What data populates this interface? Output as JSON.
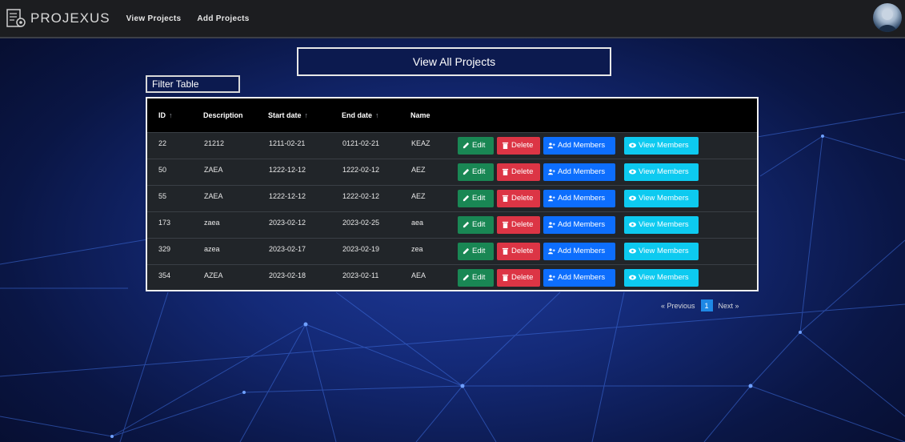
{
  "nav": {
    "brand": "PROJEXUS",
    "links": [
      "View Projects",
      "Add Projects"
    ]
  },
  "page": {
    "title": "View All Projects",
    "filter_label": "Filter Table"
  },
  "table": {
    "columns": [
      {
        "label": "ID",
        "sortable": true
      },
      {
        "label": "Description",
        "sortable": false
      },
      {
        "label": "Start date",
        "sortable": true
      },
      {
        "label": "End date",
        "sortable": true
      },
      {
        "label": "Name",
        "sortable": false
      }
    ],
    "sort_glyph": "↑",
    "rows": [
      {
        "id": "22",
        "description": "21212",
        "start": "1211-02-21",
        "end": "0121-02-21",
        "name": "KEAZ"
      },
      {
        "id": "50",
        "description": "ZAEA",
        "start": "1222-12-12",
        "end": "1222-02-12",
        "name": "AEZ"
      },
      {
        "id": "55",
        "description": "ZAEA",
        "start": "1222-12-12",
        "end": "1222-02-12",
        "name": "AEZ"
      },
      {
        "id": "173",
        "description": "zaea",
        "start": "2023-02-12",
        "end": "2023-02-25",
        "name": "aea"
      },
      {
        "id": "329",
        "description": "azea",
        "start": "2023-02-17",
        "end": "2023-02-19",
        "name": "zea"
      },
      {
        "id": "354",
        "description": "AZEA",
        "start": "2023-02-18",
        "end": "2023-02-11",
        "name": "AEA"
      }
    ],
    "actions": {
      "edit": "Edit",
      "delete": "Delete",
      "add_members": "Add Members",
      "view_members": "View Members"
    }
  },
  "pagination": {
    "prev": "« Previous",
    "current": "1",
    "next": "Next »"
  },
  "colors": {
    "edit": "#198754",
    "delete": "#dc3545",
    "add": "#0d6efd",
    "view": "#0dcaf0",
    "table_bg": "#212529",
    "header_bg": "#000000"
  }
}
